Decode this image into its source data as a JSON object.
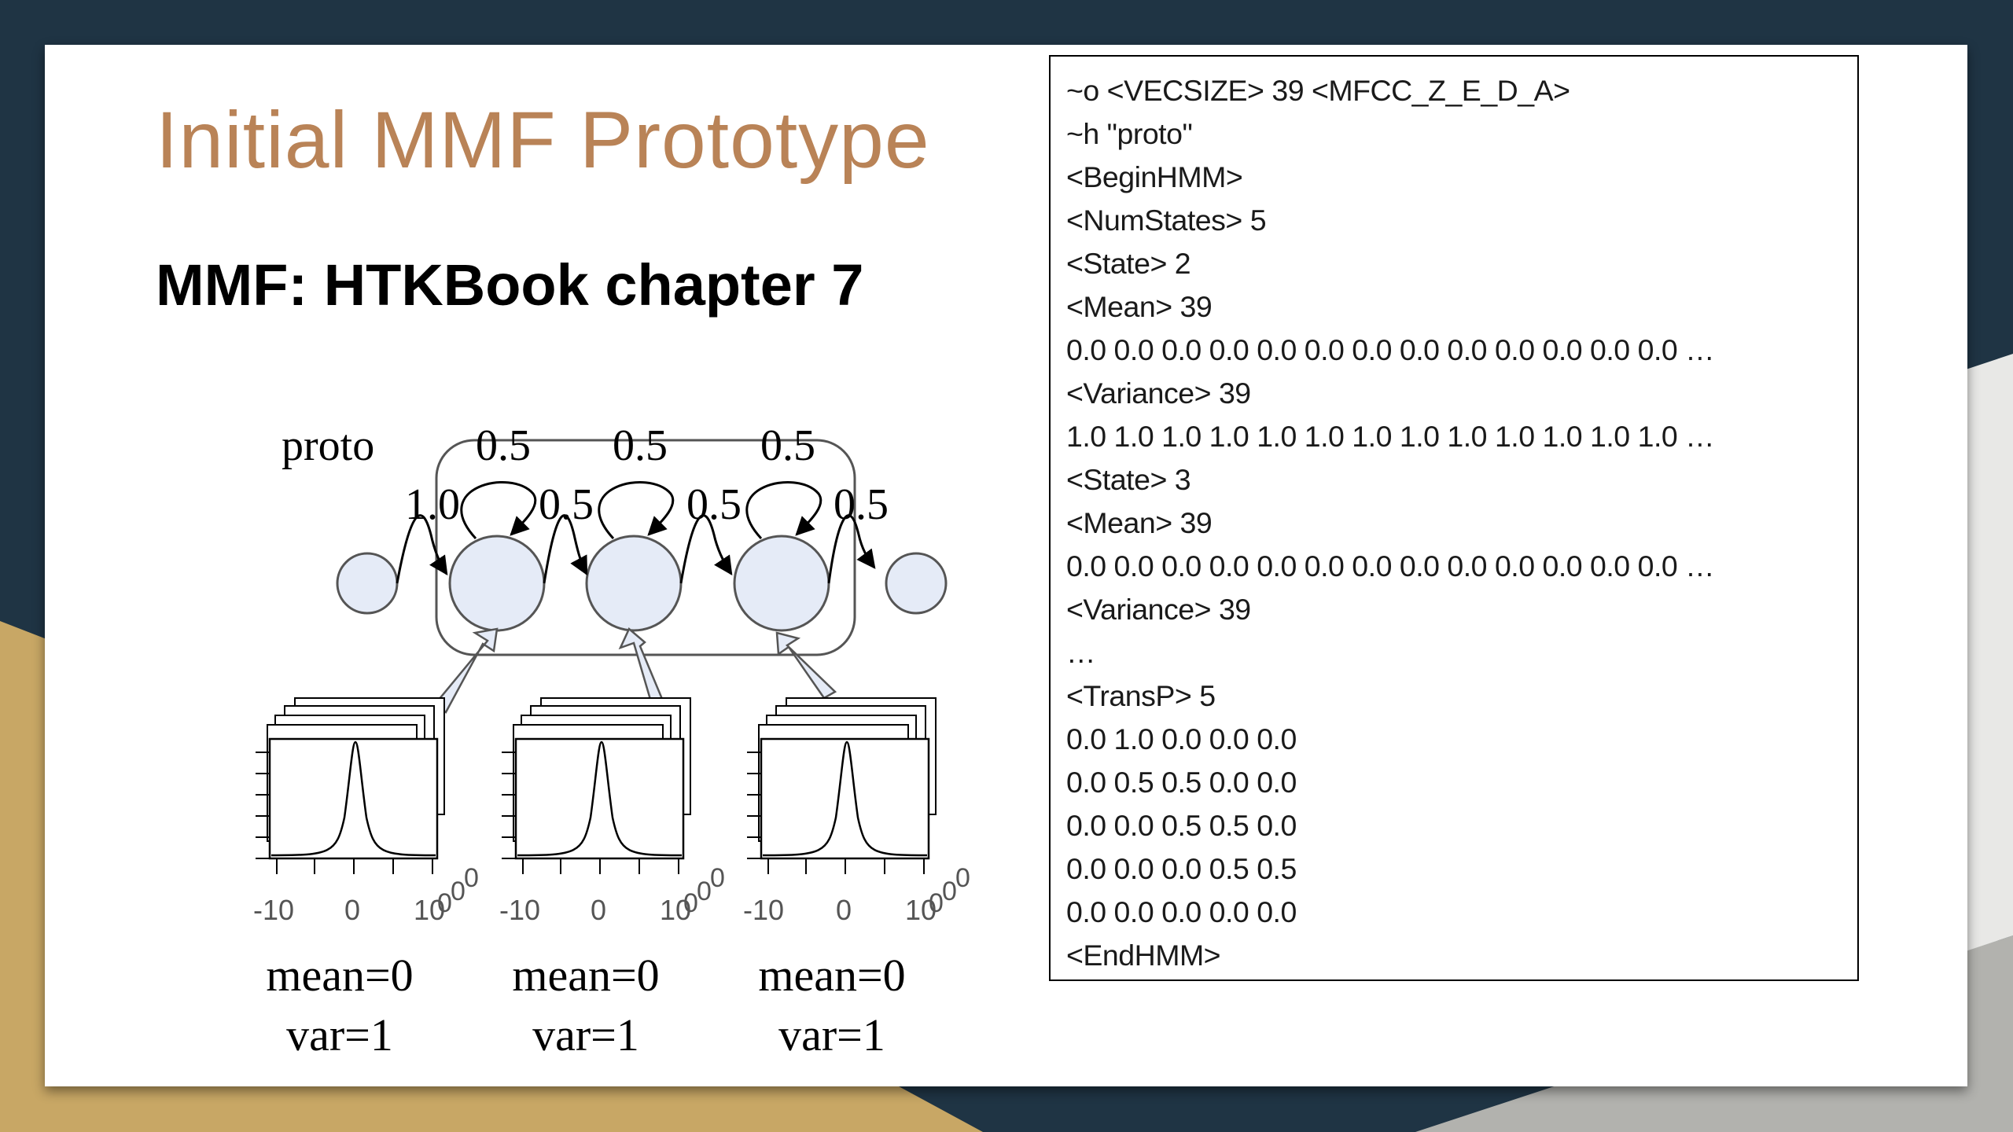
{
  "slide": {
    "title": "Initial MMF Prototype",
    "subtitle": "MMF: HTKBook chapter 7"
  },
  "figure": {
    "model_label": "proto",
    "transition_labels": [
      "0.5",
      "0.5",
      "0.5",
      "1.0",
      "0.5",
      "0.5",
      "0.5"
    ],
    "states": [
      {
        "mean_label": "mean=0",
        "var_label": "var=1"
      },
      {
        "mean_label": "mean=0",
        "var_label": "var=1"
      },
      {
        "mean_label": "mean=0",
        "var_label": "var=1"
      }
    ],
    "axis_ticks": [
      "-10",
      "0",
      "10",
      "0",
      "0",
      "0"
    ]
  },
  "code_lines": [
    "~o <VECSIZE> 39 <MFCC_Z_E_D_A>",
    "~h \"proto\"",
    "<BeginHMM>",
    "<NumStates> 5",
    "<State> 2",
    "<Mean> 39",
    "0.0 0.0 0.0 0.0 0.0 0.0 0.0 0.0 0.0 0.0 0.0 0.0 0.0 …",
    "<Variance> 39",
    "1.0 1.0 1.0 1.0 1.0 1.0 1.0 1.0 1.0 1.0 1.0 1.0 1.0 …",
    "<State> 3",
    "<Mean> 39",
    "0.0 0.0 0.0 0.0 0.0 0.0 0.0 0.0 0.0 0.0 0.0 0.0 0.0 …",
    "<Variance> 39",
    "…",
    "<TransP> 5",
    "0.0 1.0 0.0 0.0 0.0",
    "0.0 0.5 0.5 0.0 0.0",
    "0.0 0.0 0.5 0.5 0.0",
    "0.0 0.0 0.0 0.5 0.5",
    "0.0 0.0 0.0 0.0 0.0",
    "<EndHMM>"
  ],
  "colors": {
    "background_dark": "#1f3444",
    "background_gold": "#c8a765",
    "title": "#b98357",
    "state_fill": "#e5ebf7"
  }
}
